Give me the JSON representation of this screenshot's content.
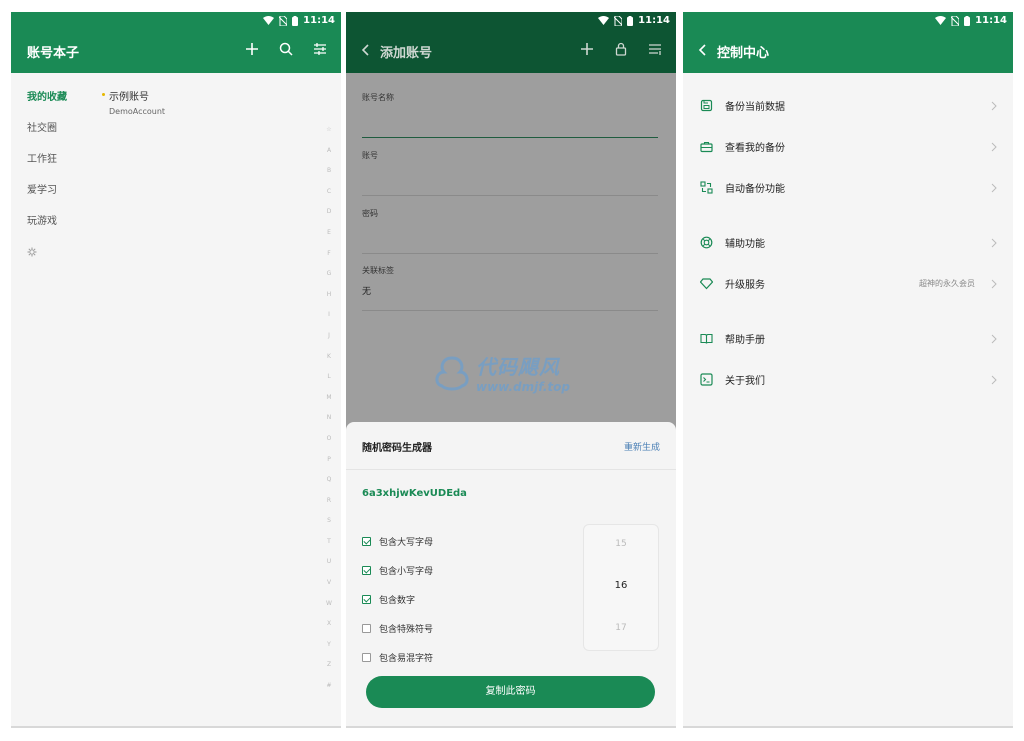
{
  "status": {
    "time": "11:14"
  },
  "screen1": {
    "title": "账号本子",
    "categories": [
      "我的收藏",
      "社交圈",
      "工作狂",
      "爱学习",
      "玩游戏"
    ],
    "entry": {
      "name": "示例账号",
      "account": "DemoAccount"
    },
    "alphabet": [
      "☆",
      "A",
      "B",
      "C",
      "D",
      "E",
      "F",
      "G",
      "H",
      "I",
      "J",
      "K",
      "L",
      "M",
      "N",
      "O",
      "P",
      "Q",
      "R",
      "S",
      "T",
      "U",
      "V",
      "W",
      "X",
      "Y",
      "Z",
      "#"
    ]
  },
  "screen2": {
    "title": "添加账号",
    "fields": [
      {
        "label": "账号名称",
        "value": ""
      },
      {
        "label": "账号",
        "value": ""
      },
      {
        "label": "密码",
        "value": ""
      },
      {
        "label": "关联标签",
        "value": "无"
      }
    ],
    "watermark": {
      "name": "代码飓风",
      "url": "www.dmjf.top"
    },
    "generator": {
      "title": "随机密码生成器",
      "regenerate": "重新生成",
      "password": "6a3xhjwKevUDEda",
      "options": [
        {
          "label": "包含大写字母",
          "checked": true
        },
        {
          "label": "包含小写字母",
          "checked": true
        },
        {
          "label": "包含数字",
          "checked": true
        },
        {
          "label": "包含特殊符号",
          "checked": false
        },
        {
          "label": "包含易混字符",
          "checked": false
        }
      ],
      "length_prev": "15",
      "length_selected": "16",
      "length_next": "17",
      "copy_button": "复制此密码"
    }
  },
  "screen3": {
    "title": "控制中心",
    "groups": [
      [
        {
          "label": "备份当前数据",
          "icon": "save-icon"
        },
        {
          "label": "查看我的备份",
          "icon": "briefcase-icon"
        },
        {
          "label": "自动备份功能",
          "icon": "sync-icon"
        }
      ],
      [
        {
          "label": "辅助功能",
          "icon": "lifebuoy-icon"
        },
        {
          "label": "升级服务",
          "icon": "diamond-icon",
          "extra": "超神的永久会员"
        }
      ],
      [
        {
          "label": "帮助手册",
          "icon": "book-icon"
        },
        {
          "label": "关于我们",
          "icon": "terminal-icon"
        }
      ]
    ]
  },
  "colors": {
    "primary": "#1a8a55",
    "background": "#f5f5f5",
    "link": "#4a7fb5"
  }
}
